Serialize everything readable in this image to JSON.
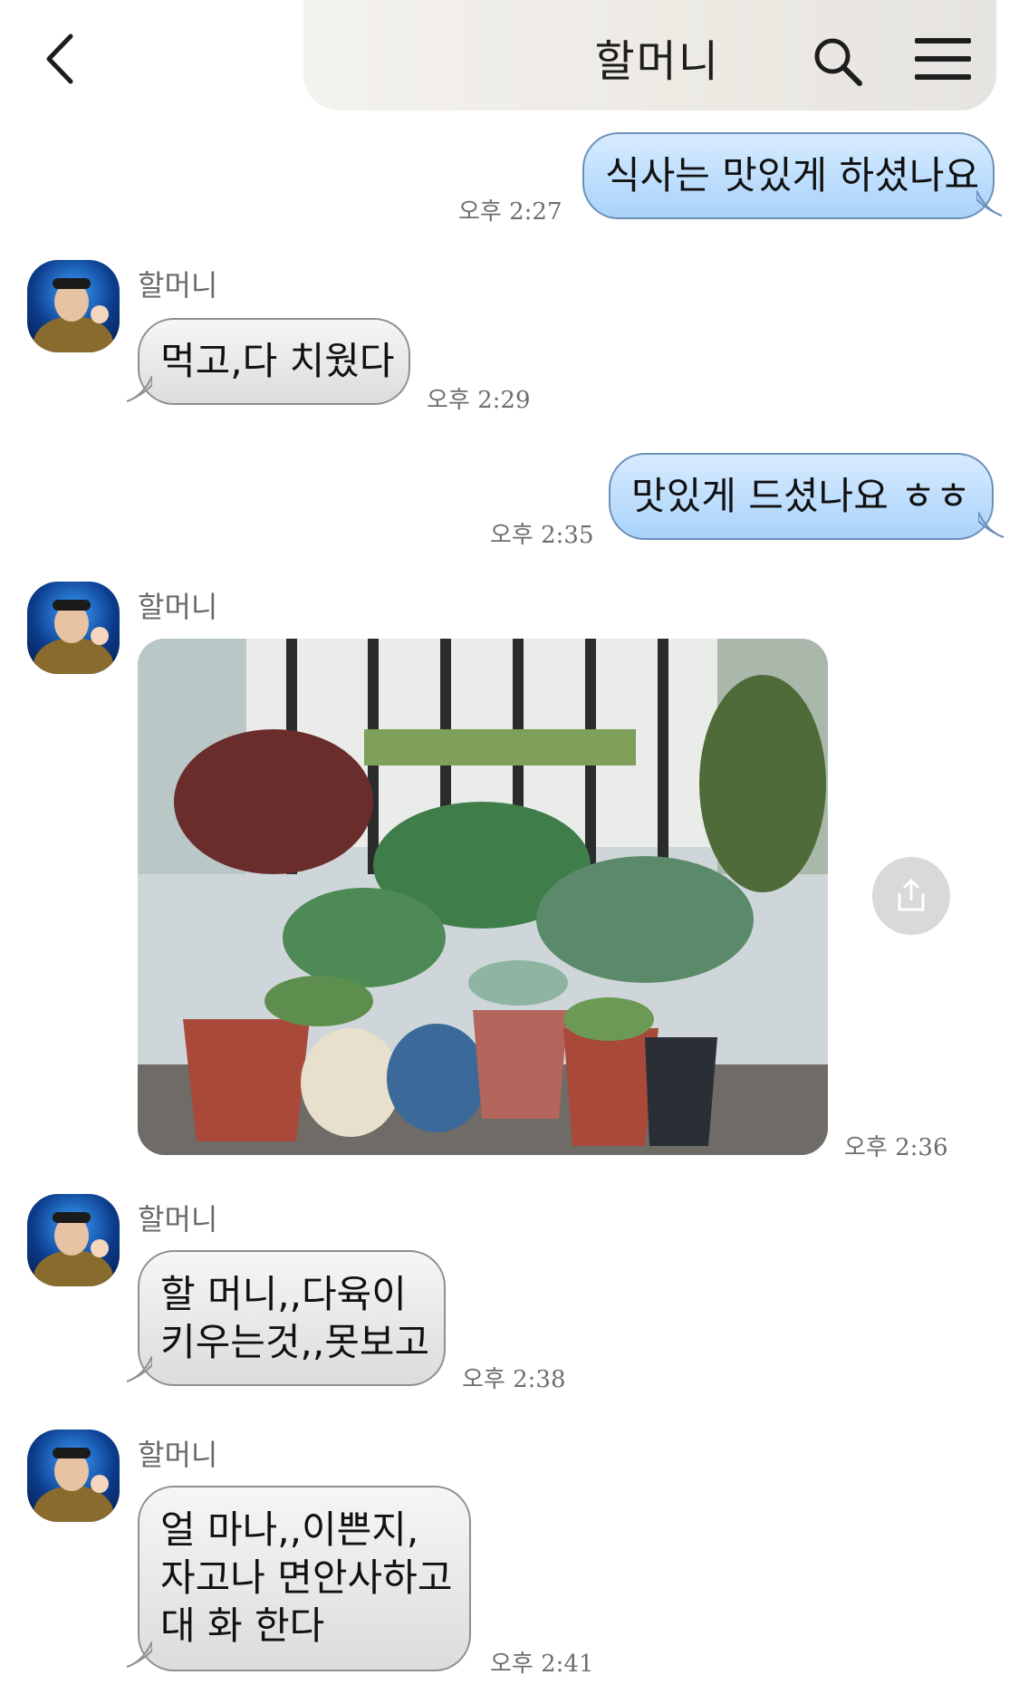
{
  "header": {
    "title": "할머니"
  },
  "messages": [
    {
      "from": "me",
      "text": "식사는 맛있게 하셨나요",
      "time": "오후 2:27"
    },
    {
      "from": "grandma",
      "sender": "할머니",
      "text": "먹고,다 치웠다",
      "time": "오후 2:29"
    },
    {
      "from": "me",
      "text": "맛있게 드셨나요 ㅎㅎ",
      "time": "오후 2:35"
    },
    {
      "from": "grandma",
      "sender": "할머니",
      "type": "photo",
      "image_label": "plants-photo",
      "time": "오후 2:36"
    },
    {
      "from": "grandma",
      "sender": "할머니",
      "lines": [
        "할 머니,,다육이",
        "키우는것,,못보고"
      ],
      "time": "오후 2:38"
    },
    {
      "from": "grandma",
      "sender": "할머니",
      "lines": [
        "얼 마나,,이쁜지,",
        "자고나 면안사하고",
        "대 화 한다"
      ],
      "time": "오후 2:41"
    }
  ],
  "icons": {
    "back": "chevron-left-icon",
    "search": "search-icon",
    "menu": "hamburger-menu-icon",
    "share": "share-icon"
  }
}
